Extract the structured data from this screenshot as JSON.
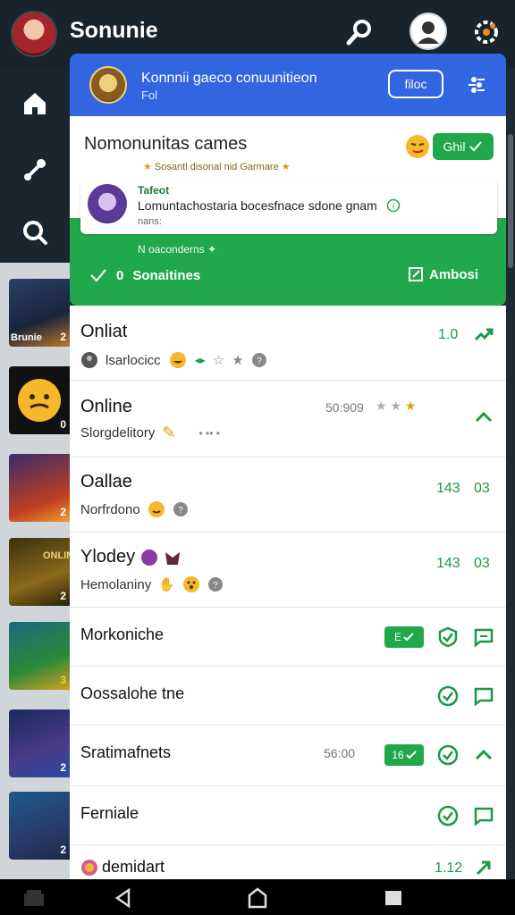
{
  "app": {
    "title": "Sonunie"
  },
  "banner": {
    "text1": "Konnnii gaeco conuunitieon",
    "text2": "Fol",
    "button_label": "filoc"
  },
  "featured": {
    "title": "Nomonunitas cames",
    "chip_label": "Ghil",
    "subtitle": "Sosantl disonal nid Garmare",
    "inner_name": "Tafeot",
    "inner_message": "Lomuntachostaria bocesfnace sdone gnam",
    "inner_meta": "nans:",
    "note": "N oaconderns",
    "left_action_count": "0",
    "left_action_label": "Sonaitines",
    "right_action_label": "Ambosi"
  },
  "thumbnails": [
    {
      "label": "Brunie",
      "num": "2"
    },
    {
      "label": "",
      "num": "0"
    },
    {
      "label": "",
      "num": "2"
    },
    {
      "label": "ONLINE",
      "num": "2"
    },
    {
      "label": "",
      "num": "3"
    },
    {
      "label": "",
      "num": "2"
    },
    {
      "label": "",
      "num": "2"
    }
  ],
  "rows": [
    {
      "title": "Onliat",
      "subtitle": "lsarlocicc",
      "num": "1.0"
    },
    {
      "title": "Online",
      "subtitle": "Slorgdelitory",
      "gray": "50:909"
    },
    {
      "title": "Oallae",
      "subtitle": "Norfrdono",
      "num": "143",
      "num2": "03"
    },
    {
      "title": "Ylodey",
      "subtitle": "Hemolaniny",
      "num": "143",
      "num2": "03"
    },
    {
      "title": "Morkoniche",
      "badge": "E"
    },
    {
      "title": "Oossalohe tne"
    },
    {
      "title": "Sratimafnets",
      "gray": "56:00",
      "badge": "16"
    },
    {
      "title": "Ferniale"
    },
    {
      "title": "demidart",
      "num": "1.12"
    }
  ],
  "colors": {
    "accent_green": "#21a84a",
    "banner_blue": "#3266e0",
    "topbar": "#18232c"
  }
}
